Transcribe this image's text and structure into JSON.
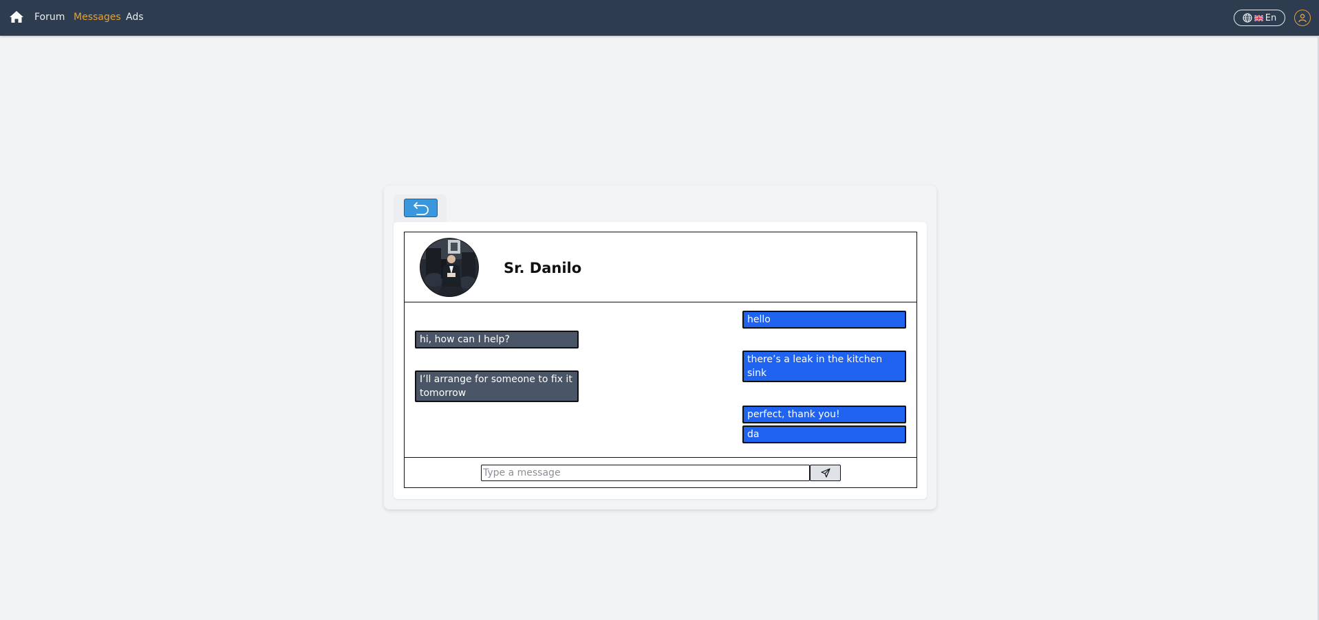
{
  "nav": {
    "home_icon": "home-icon",
    "links": [
      {
        "label": "Forum",
        "active": false
      },
      {
        "label": "Messages",
        "active": true
      },
      {
        "label": "Ads",
        "active": false
      }
    ],
    "language": {
      "icon": "globe-icon",
      "flag": "uk-flag-icon",
      "label": "En"
    },
    "user_icon": "user-icon",
    "colors": {
      "bar": "#2e3c4f",
      "active": "#e3a23b",
      "text": "#e9edf2"
    }
  },
  "conversation": {
    "back_icon": "undo-arrow-icon",
    "contact": {
      "name": "Sr. Danilo",
      "avatar": "contact-photo"
    },
    "messages": [
      {
        "from": "me",
        "text": "hello"
      },
      {
        "from": "them",
        "text": "hi, how can I help?"
      },
      {
        "from": "me",
        "text": "there’s a leak in the kitchen sink"
      },
      {
        "from": "them",
        "text": "I’ll arrange for someone to fix it tomorrow"
      },
      {
        "from": "me",
        "text": "perfect, thank you!"
      },
      {
        "from": "me",
        "text": "da"
      }
    ],
    "input": {
      "value": "",
      "placeholder": "Type a message"
    },
    "send_icon": "send-icon",
    "colors": {
      "sent": "#1f63f0",
      "received": "#4a5568",
      "back_button": "#3a97de"
    }
  }
}
